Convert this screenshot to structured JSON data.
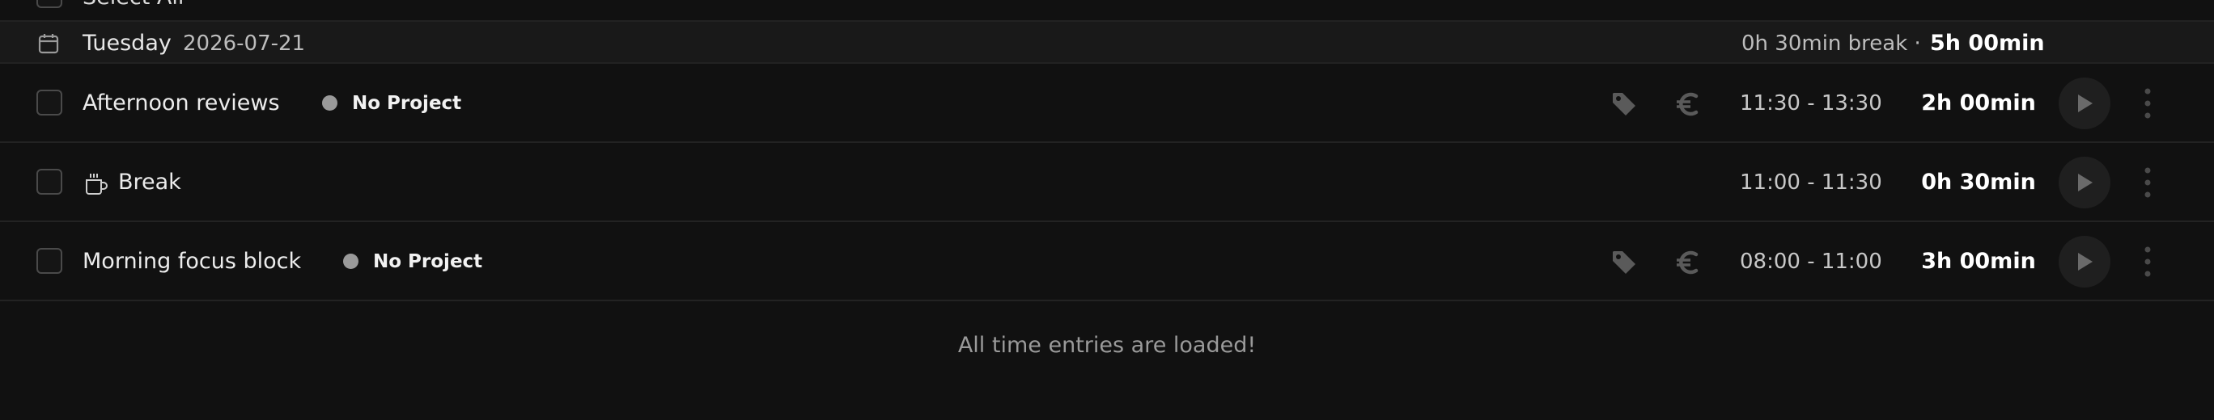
{
  "select_all": {
    "label": "Select All"
  },
  "day": {
    "weekday": "Tuesday",
    "date": "2026-07-21",
    "break_summary": "0h 30min break ·",
    "total": "5h 00min"
  },
  "entries": [
    {
      "description": "Afternoon reviews",
      "project": "No Project",
      "time_range": "11:30 - 13:30",
      "duration": "2h 00min",
      "has_tag_billable": true,
      "project_color": "#9a9a9a"
    },
    {
      "description": "Break",
      "project": "",
      "time_range": "11:00 - 11:30",
      "duration": "0h 30min",
      "is_break": true
    },
    {
      "description": "Morning focus block",
      "project": "No Project",
      "time_range": "08:00 - 11:00",
      "duration": "3h 00min",
      "has_tag_billable": true,
      "project_color": "#9a9a9a"
    }
  ],
  "footer": {
    "message": "All time entries are loaded!"
  },
  "icons": {
    "calendar": "calendar-icon",
    "tag": "tag-icon",
    "billable": "euro-icon",
    "play": "play-icon",
    "more": "more-vertical-icon",
    "break": "coffee-cup-icon"
  },
  "colors": {
    "background": "#111111",
    "header_bg": "#191919",
    "muted_icon": "#5a5a5a"
  }
}
